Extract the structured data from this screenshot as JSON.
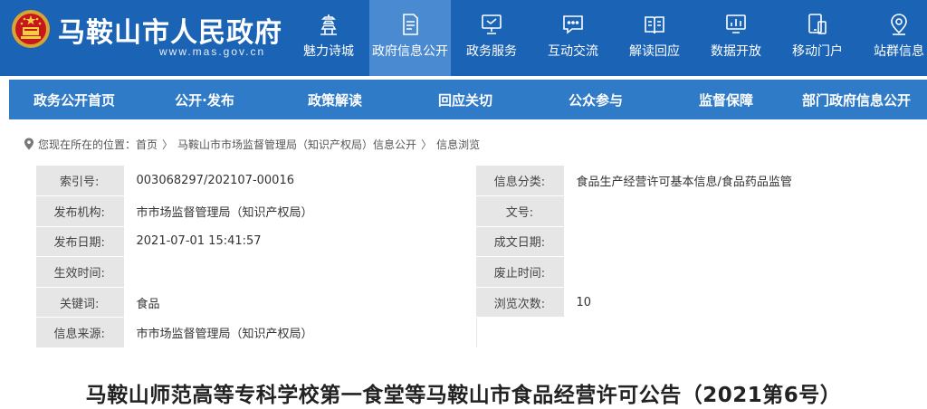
{
  "header": {
    "site_title": "马鞍山市人民政府",
    "site_url": "www.mas.gov.cn",
    "colors": {
      "header_bg": "#1b63b4",
      "active_tab": "#4a8ad0",
      "subnav_bg": "#2f7bc8"
    },
    "nav": [
      {
        "label": "魅力诗城",
        "icon": "pagoda-icon"
      },
      {
        "label": "政府信息公开",
        "icon": "document-list-icon",
        "active": true
      },
      {
        "label": "政务服务",
        "icon": "monitor-icon"
      },
      {
        "label": "互动交流",
        "icon": "chat-bubble-icon"
      },
      {
        "label": "解读回应",
        "icon": "open-book-icon"
      },
      {
        "label": "数据开放",
        "icon": "bar-chart-screen-icon"
      },
      {
        "label": "移动门户",
        "icon": "mobile-tablet-icon"
      },
      {
        "label": "站群信息",
        "icon": "location-pin-icon"
      }
    ]
  },
  "subnav": [
    "政务公开首页",
    "公开·发布",
    "政策解读",
    "回应关切",
    "公众参与",
    "监督保障",
    "部门政府信息公开"
  ],
  "breadcrumb": {
    "prefix": "您现在所在的位置：",
    "items": [
      "首页",
      "马鞍山市市场监督管理局（知识产权局）信息公开",
      "信息浏览"
    ],
    "separator": "〉"
  },
  "info": {
    "rows": [
      {
        "k1": "索引号:",
        "v1": "003068297/202107-00016",
        "k2": "信息分类:",
        "v2": "食品生产经营许可基本信息/食品药品监管"
      },
      {
        "k1": "发布机构:",
        "v1": "市市场监督管理局（知识产权局）",
        "k2": "文号:",
        "v2": ""
      },
      {
        "k1": "发布日期:",
        "v1": "2021-07-01 15:41:57",
        "k2": "成文日期:",
        "v2": ""
      },
      {
        "k1": "生效时间:",
        "v1": "",
        "k2": "废止时间:",
        "v2": ""
      },
      {
        "k1": "关键词:",
        "v1": "食品",
        "k2": "浏览次数:",
        "v2": "10"
      },
      {
        "k1": "信息来源:",
        "v1": "市市场监督管理局（知识产权局）",
        "k2": "",
        "v2": ""
      }
    ]
  },
  "article": {
    "title": "马鞍山师范高等专科学校第一食堂等马鞍山市食品经营许可公告（2021第6号）"
  }
}
